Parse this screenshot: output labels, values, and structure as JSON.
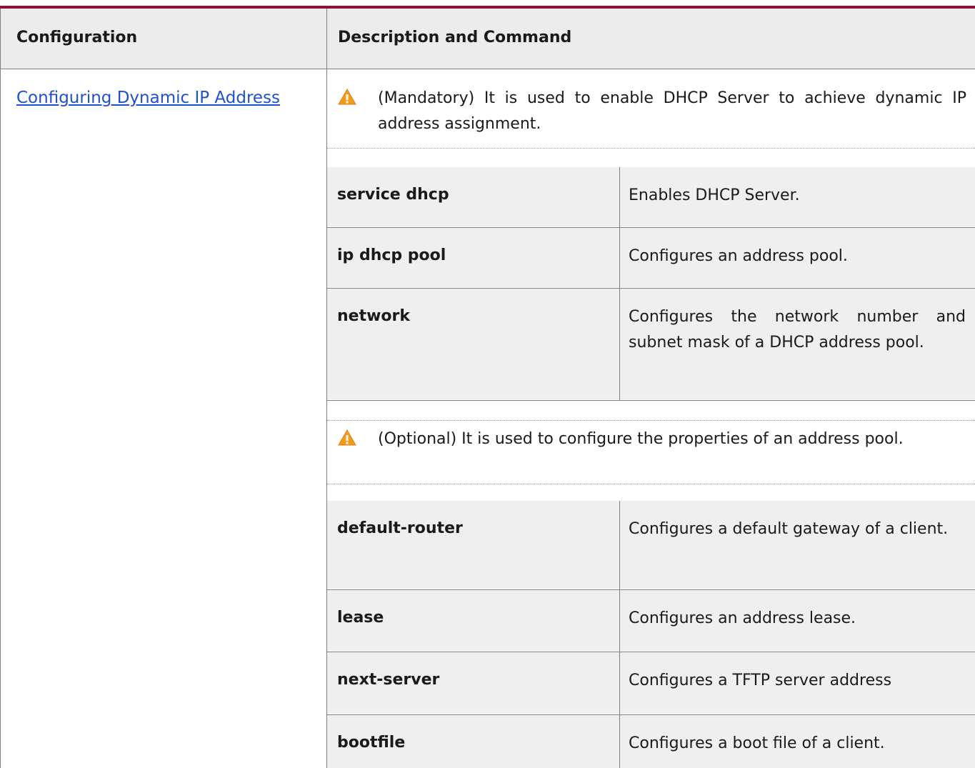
{
  "header": {
    "col1": "Configuration",
    "col2": "Description and Command"
  },
  "config_link": "Configuring Dynamic IP Address",
  "notes": [
    "(Mandatory) It is used to enable DHCP Server to achieve dynamic IP address assignment.",
    "(Optional) It is used to configure the properties of an address pool."
  ],
  "commands": [
    {
      "cmd": "service dhcp",
      "desc": "Enables DHCP Server."
    },
    {
      "cmd": "ip dhcp pool",
      "desc": "Configures an address pool."
    },
    {
      "cmd": "network",
      "desc": "Configures the network number and subnet mask of a DHCP address pool."
    },
    {
      "cmd": "default-router",
      "desc": "Configures a default gateway of a client."
    },
    {
      "cmd": "lease",
      "desc": "Configures an address lease."
    },
    {
      "cmd": "next-server",
      "desc": "Configures a TFTP server address"
    },
    {
      "cmd": "bootfile",
      "desc": "Configures a boot file of a client."
    }
  ],
  "colors": {
    "top_border": "#8b1438",
    "header_bg": "#ececec",
    "cell_bg": "#efefef",
    "link": "#1f4fd6",
    "warning": "#f39c12"
  },
  "icons": [
    "warning-icon"
  ]
}
